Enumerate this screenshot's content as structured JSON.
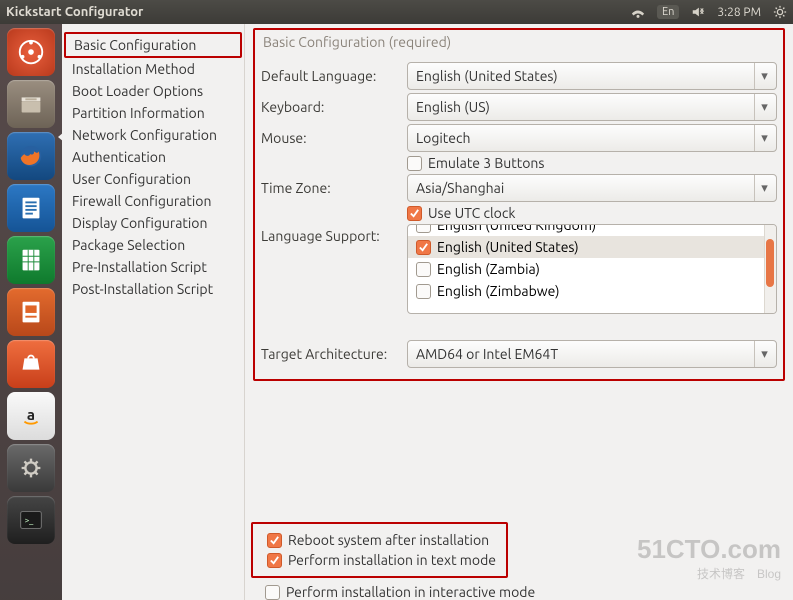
{
  "menubar": {
    "title": "Kickstart Configurator",
    "lang_indicator": "En",
    "time": "3:28 PM"
  },
  "sidebar": {
    "items": [
      {
        "label": "Basic Configuration",
        "selected": true
      },
      {
        "label": "Installation Method"
      },
      {
        "label": "Boot Loader Options"
      },
      {
        "label": "Partition Information"
      },
      {
        "label": "Network Configuration"
      },
      {
        "label": "Authentication"
      },
      {
        "label": "User Configuration"
      },
      {
        "label": "Firewall Configuration"
      },
      {
        "label": "Display Configuration"
      },
      {
        "label": "Package Selection"
      },
      {
        "label": "Pre-Installation Script"
      },
      {
        "label": "Post-Installation Script"
      }
    ]
  },
  "section_title": "Basic Configuration (required)",
  "form": {
    "default_language": {
      "label": "Default Language:",
      "value": "English (United States)"
    },
    "keyboard": {
      "label": "Keyboard:",
      "value": "English (US)"
    },
    "mouse": {
      "label": "Mouse:",
      "value": "Logitech"
    },
    "emulate3": {
      "label": "Emulate 3 Buttons",
      "checked": false
    },
    "time_zone": {
      "label": "Time Zone:",
      "value": "Asia/Shanghai"
    },
    "utc": {
      "label": "Use UTC clock",
      "checked": true
    },
    "language_support": {
      "label": "Language Support:"
    },
    "lang_list": [
      {
        "label": "English (United Kingdom)",
        "checked": false,
        "cut": true
      },
      {
        "label": "English (United States)",
        "checked": true,
        "selected": true
      },
      {
        "label": "English (Zambia)",
        "checked": false
      },
      {
        "label": "English (Zimbabwe)",
        "checked": false
      }
    ],
    "target_arch": {
      "label": "Target Architecture:",
      "value": "AMD64 or Intel EM64T"
    }
  },
  "options": {
    "reboot": {
      "label": "Reboot system after installation",
      "checked": true
    },
    "textmode": {
      "label": "Perform installation in text mode",
      "checked": true
    },
    "interactive": {
      "label": "Perform installation in interactive mode",
      "checked": false
    }
  },
  "watermark": {
    "big": "51CTO.com",
    "sm": "技术博客　Blog"
  },
  "colors": {
    "accent": "#f07746"
  }
}
